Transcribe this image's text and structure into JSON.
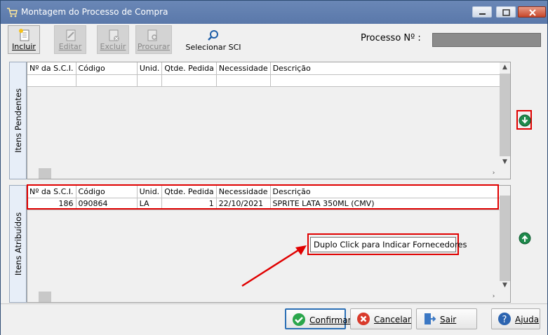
{
  "window": {
    "title": "Montagem do Processo de Compra"
  },
  "toolbar": {
    "buttons": [
      {
        "label": "Incluir",
        "state": "active"
      },
      {
        "label": "Editar",
        "state": "disabled"
      },
      {
        "label": "Excluir",
        "state": "disabled"
      },
      {
        "label": "Procurar",
        "state": "disabled"
      }
    ],
    "select_sci_label": "Selecionar SCI",
    "processo_label": "Processo Nº :",
    "processo_value": ""
  },
  "pending": {
    "tab_label": "Itens Pendentes",
    "columns": [
      "Nº da S.C.I.",
      "Código",
      "Unid.",
      "Qtde. Pedida",
      "Necessidade",
      "Descrição"
    ],
    "rows": []
  },
  "assigned": {
    "tab_label": "Itens Atribuídos",
    "columns": [
      "Nº da S.C.I.",
      "Código",
      "Unid.",
      "Qtde. Pedida",
      "Necessidade",
      "Descrição"
    ],
    "rows": [
      {
        "sci": "186",
        "codigo": "090864",
        "unid": "LA",
        "qtde": "1",
        "necessidade": "22/10/2021",
        "descricao": "SPRITE LATA 350ML (CMV)"
      }
    ]
  },
  "tooltip": {
    "text": "Duplo Click para Indicar Fornecedores"
  },
  "bottom": {
    "confirm": "Confirmar",
    "cancel": "Cancelar",
    "exit": "Sair",
    "help": "Ajuda"
  },
  "colors": {
    "highlight": "#e00000",
    "titlebar": "#5a78aa",
    "accent_green": "#1e8a4c"
  }
}
